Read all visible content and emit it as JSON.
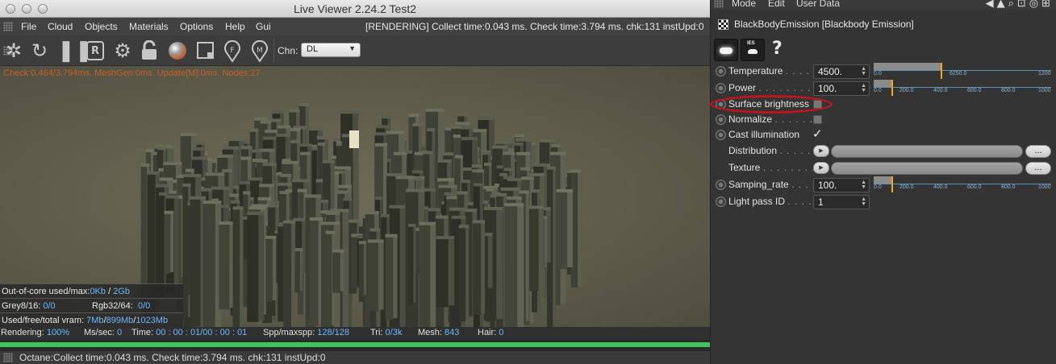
{
  "window": {
    "title": "Live Viewer 2.24.2 Test2"
  },
  "menu": {
    "items": [
      "File",
      "Cloud",
      "Objects",
      "Materials",
      "Options",
      "Help",
      "Gui"
    ],
    "status": "[RENDERING] Collect time:0.043 ms.  Check time:3.794 ms.  chk:131  instUpd:0"
  },
  "toolbar": {
    "icons": [
      "aperture-icon",
      "refresh-icon",
      "pause-icon",
      "region-icon",
      "gear-icon",
      "lock-icon",
      "material-ball-icon",
      "crop-icon",
      "focus-pin-icon",
      "material-pin-icon"
    ],
    "region_label": "R",
    "focus_label": "F",
    "material_label": "M",
    "chn_label": "Chn:",
    "chn_value": "DL"
  },
  "viewport": {
    "hud": "Check:0.464/3.794ms. MeshGen:0ms. Update[M]:0ms. Nodes:27",
    "info": {
      "ooc_label": "Out-of-core used/max:",
      "ooc_value": "0Kb",
      "ooc_max": "2Gb",
      "grey_label": "Grey8/16:",
      "grey_value": "0/0",
      "rgb_label": "Rgb32/64:",
      "rgb_value": "0/0",
      "vram_label": "Used/free/total vram:",
      "vram_used": "7Mb",
      "vram_free": "899Mb",
      "vram_total": "1023Mb"
    }
  },
  "render_stats": {
    "rendering_label": "Rendering:",
    "rendering_value": "100%",
    "ms_label": "Ms/sec:",
    "ms_value": "0",
    "time_label": "Time:",
    "time_value": "00 : 00 : 01/00 : 00 : 01",
    "spp_label": "Spp/maxspp:",
    "spp_value": "128/128",
    "tri_label": "Tri:",
    "tri_value": "0/3k",
    "mesh_label": "Mesh:",
    "mesh_value": "843",
    "hair_label": "Hair:",
    "hair_value": "0",
    "progress": 1.0
  },
  "statusbar": {
    "text": "Octane:Collect time:0.043 ms.  Check time:3.794 ms.  chk:131  instUpd:0"
  },
  "panel": {
    "menu": [
      "Mode",
      "Edit",
      "User Data"
    ],
    "object_title": "BlackBodyEmission [Blackbody Emission]",
    "ies_label": "IES",
    "help": "?",
    "props": {
      "temperature": {
        "label": "Temperature",
        "dots": ". . . . .",
        "value": "4500.",
        "ticks": [
          "0.0",
          "6250.0",
          "1200"
        ],
        "level": 0.375
      },
      "power": {
        "label": "Power",
        "dots": ". . . . . . . . . .",
        "value": "100.",
        "ticks": [
          "0.0",
          "200.0",
          "400.0",
          "600.0",
          "800.0",
          "1000"
        ],
        "level": 0.1
      },
      "surface_brightness": {
        "label": "Surface brightness",
        "checked": false
      },
      "normalize": {
        "label": "Normalize",
        "dots": ". . . . . . .",
        "checked": false
      },
      "cast_illumination": {
        "label": "Cast illumination",
        "checked": true,
        "mark": "✓"
      },
      "distribution": {
        "label": "Distribution",
        "dots": ". . . . .",
        "button": "..."
      },
      "texture": {
        "label": "Texture",
        "dots": ". . . . . . . . .",
        "button": "..."
      },
      "sampling_rate": {
        "label": "Samping_rate",
        "dots": ". . . .",
        "value": "100.",
        "ticks": [
          "0.0",
          "200.0",
          "400.0",
          "600.0",
          "800.0",
          "1000"
        ],
        "level": 0.1
      },
      "light_pass_id": {
        "label": "Light pass ID",
        "dots": ". . . .",
        "value": "1"
      }
    }
  }
}
